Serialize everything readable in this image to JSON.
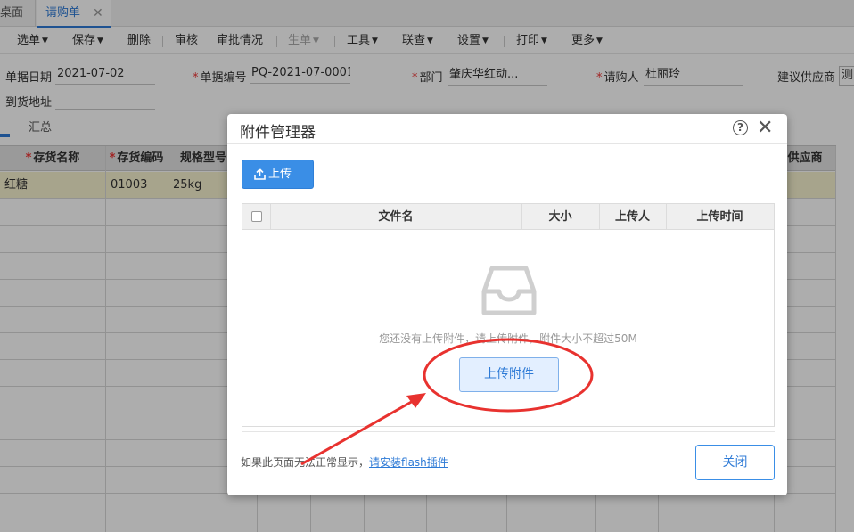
{
  "tabs": {
    "desk_label": "桌面",
    "active_label": "请购单",
    "close_glyph": "✕"
  },
  "toolbar": {
    "items": [
      {
        "label": "选单",
        "dropdown": true,
        "disabled": false
      },
      {
        "label": "保存",
        "dropdown": true,
        "disabled": false
      },
      {
        "label": "删除",
        "dropdown": false,
        "disabled": false
      },
      {
        "label": "审核",
        "dropdown": false,
        "disabled": false
      },
      {
        "label": "审批情况",
        "dropdown": false,
        "disabled": false
      },
      {
        "label": "生单",
        "dropdown": true,
        "disabled": true
      },
      {
        "label": "工具",
        "dropdown": true,
        "disabled": false
      },
      {
        "label": "联查",
        "dropdown": true,
        "disabled": false
      },
      {
        "label": "设置",
        "dropdown": true,
        "disabled": false
      },
      {
        "label": "打印",
        "dropdown": true,
        "disabled": false
      },
      {
        "label": "更多",
        "dropdown": true,
        "disabled": false
      }
    ]
  },
  "form": {
    "date_label": "单据日期",
    "date_value": "2021-07-02",
    "number_label": "单据编号",
    "number_value": "PQ-2021-07-0001",
    "dept_label": "部门",
    "dept_value": "肇庆华红动...",
    "requester_label": "请购人",
    "requester_value": "杜丽玲",
    "supplier_label": "建议供应商",
    "supplier_value": "测",
    "address_label": "到货地址",
    "required_mark": "*"
  },
  "summary_tab": "汇总",
  "grid": {
    "headers": [
      {
        "label": "存货名称",
        "required": true
      },
      {
        "label": "存货编码",
        "required": true
      },
      {
        "label": "规格型号",
        "required": false
      },
      {
        "label": "供应商",
        "required": false
      }
    ],
    "rows": [
      {
        "name": "红糖",
        "code": "01003",
        "spec": "25kg"
      }
    ]
  },
  "dialog": {
    "title": "附件管理器",
    "help_glyph": "?",
    "close_glyph": "✕",
    "upload_button": "上传",
    "columns": [
      "文件名",
      "大小",
      "上传人",
      "上传时间"
    ],
    "empty_text": "您还没有上传附件，请上传附件，附件大小不超过50M",
    "upload_attach_button": "上传附件",
    "flash_note": "如果此页面无法正常显示，",
    "flash_link": "请安装flash插件",
    "close_button": "关闭"
  },
  "icons": {
    "upload": "upload-icon",
    "inbox": "empty-inbox-icon",
    "help": "help-circle-icon",
    "close": "close-icon"
  },
  "colors": {
    "accent": "#2d7ad6",
    "button_blue": "#3a8ee6",
    "row_highlight": "#f7f2cf",
    "annotation_red": "#e8322f",
    "required_red": "#e33333"
  }
}
